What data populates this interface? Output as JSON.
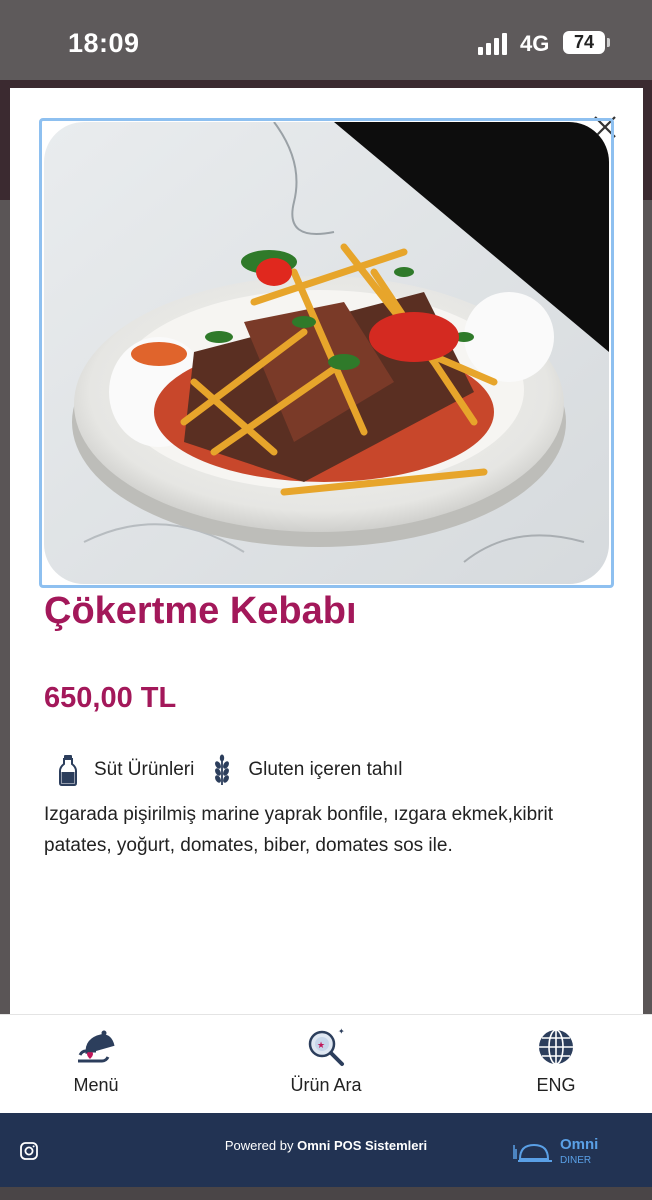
{
  "status_bar": {
    "time": "18:09",
    "network": "4G",
    "battery": "74"
  },
  "product": {
    "title": "Çökertme Kebabı",
    "price": "650,00 TL",
    "allergens": [
      {
        "label": "Süt Ürünleri",
        "icon": "milk-bottle-icon"
      },
      {
        "label": "Gluten içeren tahıl",
        "icon": "wheat-icon"
      }
    ],
    "description": "Izgarada pişirilmiş marine yaprak bonfile, ızgara ekmek,kibrit patates, yoğurt, domates, biber, domates sos ile."
  },
  "nav": {
    "menu_label": "Menü",
    "search_label": "Ürün Ara",
    "language_label": "ENG"
  },
  "footer": {
    "powered_prefix": "Powered by",
    "powered_brand": "Omni POS Sistemleri",
    "logo_line1": "Omni",
    "logo_line2": "DINER"
  },
  "colors": {
    "accent": "#a3185a",
    "footer_bg": "#223353",
    "image_border": "#8ec0f0"
  }
}
